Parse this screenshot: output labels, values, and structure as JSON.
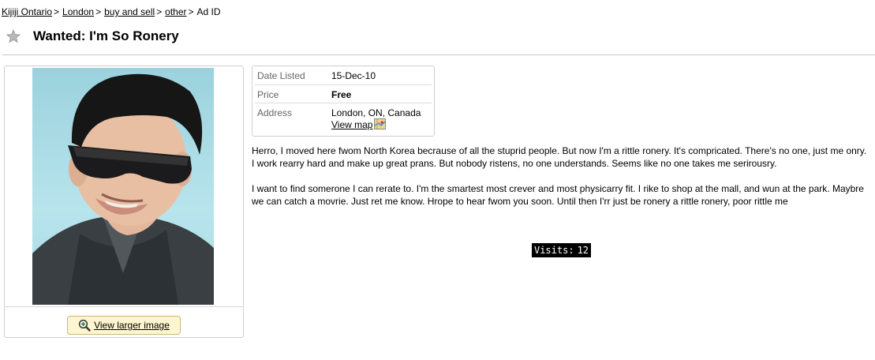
{
  "breadcrumb": {
    "items": [
      "Kijiji Ontario",
      "London",
      "buy and sell",
      "other"
    ],
    "separator": ">",
    "current": "Ad ID"
  },
  "ad": {
    "title": "Wanted: I'm So Ronery",
    "favorite_icon": "star-icon"
  },
  "photo": {
    "alt": "Ad photo",
    "view_larger_label": "View larger image",
    "button_icon": "magnifier-icon"
  },
  "details": {
    "date_label": "Date Listed",
    "date_value": "15-Dec-10",
    "price_label": "Price",
    "price_value": "Free",
    "address_label": "Address",
    "address_value": "London, ON, Canada",
    "view_map_label": "View map",
    "map_icon": "map-icon"
  },
  "description": {
    "paragraph1": "Herro, I moved here fwom North Korea becrause of all the stuprid people. But now I'm a rittle ronery. It's compricated.  There's no one, just me onry. I work rearry hard and make up great prans. But nobody ristens, no one understands. Seems like no one takes me serirousry.",
    "paragraph2": "I want to find somerone I can rerate to. I'm the smartest most crever and most physicarry fit. I rike to shop at the mall, and wun at the park. Maybre we can catch a movrie. Just ret me know. Hrope to hear fwom you soon. Until then I'rr just be ronery a rittle ronery, poor rittle me"
  },
  "visits": {
    "label": "Visits:",
    "count": "12"
  },
  "colors": {
    "button_bg": "#fff6cf",
    "visits_bg": "#000000",
    "label_gray": "#666666"
  }
}
